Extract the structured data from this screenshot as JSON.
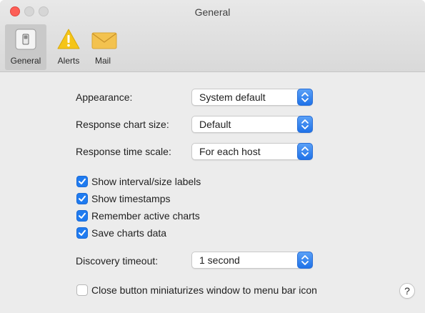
{
  "window": {
    "title": "General"
  },
  "toolbar": {
    "tabs": [
      {
        "label": "General",
        "icon": "switch-icon",
        "selected": true
      },
      {
        "label": "Alerts",
        "icon": "warning-icon",
        "selected": false
      },
      {
        "label": "Mail",
        "icon": "envelope-icon",
        "selected": false
      }
    ]
  },
  "settings": {
    "appearance": {
      "label": "Appearance:",
      "value": "System default"
    },
    "chart_size": {
      "label": "Response chart size:",
      "value": "Default"
    },
    "time_scale": {
      "label": "Response time scale:",
      "value": "For each host"
    },
    "discovery": {
      "label": "Discovery timeout:",
      "value": "1 second"
    }
  },
  "checkboxes": [
    {
      "label": "Show interval/size labels",
      "checked": true
    },
    {
      "label": "Show timestamps",
      "checked": true
    },
    {
      "label": "Remember active charts",
      "checked": true
    },
    {
      "label": "Save charts data",
      "checked": true
    },
    {
      "label": "Close button miniaturizes window to menu bar icon",
      "checked": false
    }
  ],
  "help": {
    "label": "?"
  },
  "colors": {
    "accent": "#1f7bf0",
    "close_button": "#fd5f57",
    "warning": "#f5c518",
    "mail": "#f3c24f"
  }
}
